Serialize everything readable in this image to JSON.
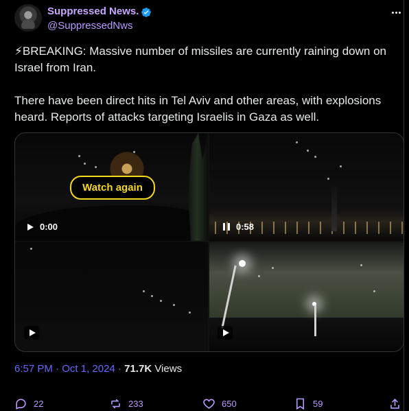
{
  "author": {
    "display_name": "Suppressed News.",
    "handle": "@SuppressedNws",
    "avatar_icon": "hooded-person-avatar",
    "verified_icon": "verified-badge-icon"
  },
  "tweet": {
    "paragraph_1": "⚡BREAKING: Massive number of missiles are currently raining down on Israel from Iran.",
    "paragraph_2": "There have been direct hits in Tel Aviv and other areas, with explosions heard. Reports of attacks targeting Israelis in Gaza as well."
  },
  "media": {
    "watch_again": "Watch again",
    "video_1_time": "0:00",
    "video_2_time": "0:58"
  },
  "meta": {
    "time": "6:57 PM",
    "separator": "·",
    "date": "Oct 1, 2024",
    "views_count": "71.7K",
    "views_label": "Views"
  },
  "actions": {
    "replies": "22",
    "reposts": "233",
    "likes": "650",
    "bookmarks": "59"
  },
  "colors": {
    "name_color": "#c8a8ff",
    "accent": "#b89cff",
    "watch_again": "#f6d91a"
  }
}
